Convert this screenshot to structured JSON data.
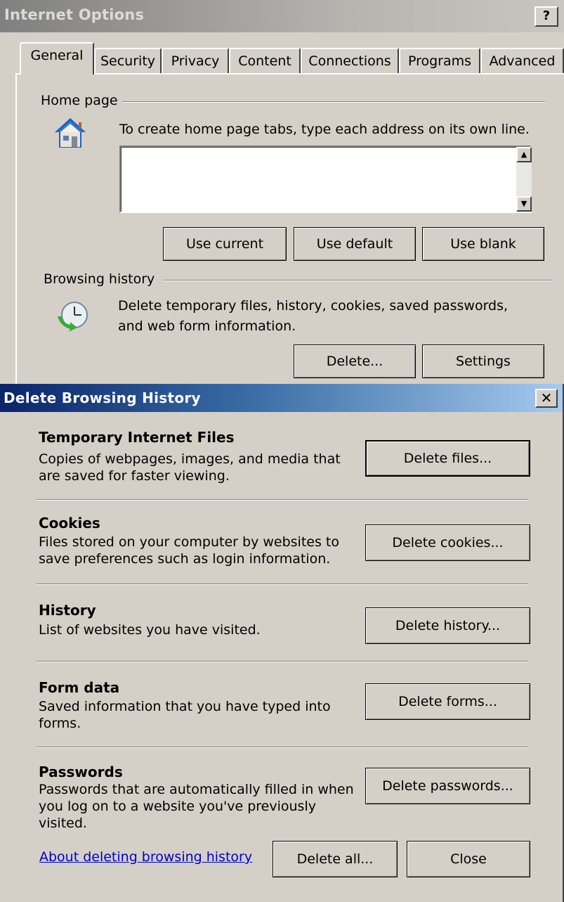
{
  "internet_options": {
    "title": "Internet Options",
    "help_label": "?",
    "tabs": [
      "General",
      "Security",
      "Privacy",
      "Content",
      "Connections",
      "Programs",
      "Advanced"
    ],
    "active_tab": "General",
    "home_page": {
      "group_label": "Home page",
      "instruction": "To create home page tabs, type each address on its own line.",
      "value": "",
      "buttons": {
        "use_current": "Use current",
        "use_default": "Use default",
        "use_blank": "Use blank"
      }
    },
    "browsing_history": {
      "group_label": "Browsing history",
      "description_line1": "Delete temporary files, history, cookies, saved passwords,",
      "description_line2": "and web form information.",
      "buttons": {
        "delete": "Delete...",
        "settings": "Settings"
      }
    },
    "icons": {
      "home": "house-icon",
      "history": "history-clock-icon"
    }
  },
  "delete_browsing_history": {
    "title": "Delete Browsing History",
    "close_label": "✕",
    "sections": [
      {
        "heading": "Temporary Internet Files",
        "lines": [
          "Copies of webpages, images, and media that",
          "are saved for faster viewing."
        ],
        "button": "Delete files..."
      },
      {
        "heading": "Cookies",
        "lines": [
          "Files stored on your computer by websites to",
          "save preferences such as login information."
        ],
        "button": "Delete cookies..."
      },
      {
        "heading": "History",
        "lines": [
          "List of websites you have visited."
        ],
        "button": "Delete history..."
      },
      {
        "heading": "Form data",
        "lines": [
          "Saved information that you have typed into",
          "forms."
        ],
        "button": "Delete forms..."
      },
      {
        "heading": "Passwords",
        "lines": [
          "Passwords that are automatically filled in when",
          "you log on to a website you've previously",
          "visited."
        ],
        "button": "Delete passwords..."
      }
    ],
    "footer": {
      "link": "About deleting browsing history",
      "delete_all": "Delete all...",
      "close": "Close"
    }
  },
  "colors": {
    "face": "#d4d0c8",
    "title_active_start": "#0a246a",
    "title_active_end": "#a6caf0",
    "title_inactive": "#808080",
    "link": "#0000cc"
  }
}
